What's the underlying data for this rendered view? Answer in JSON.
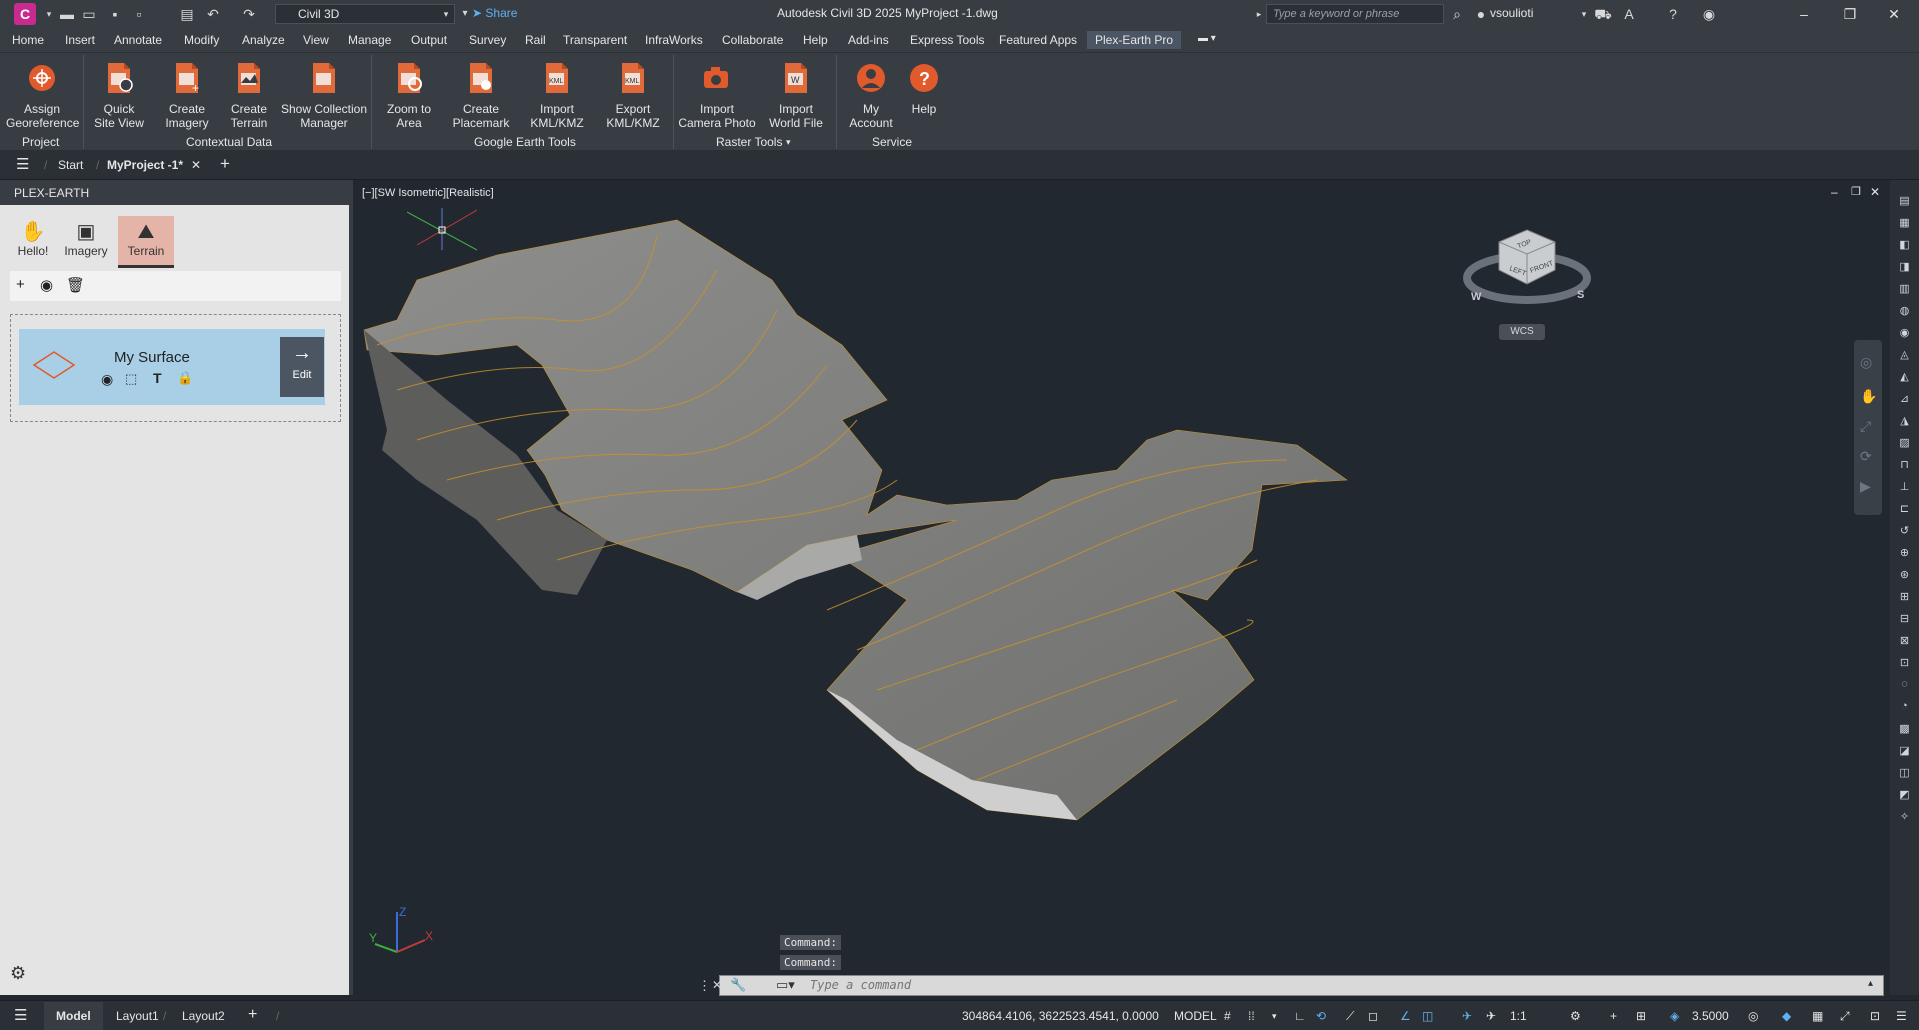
{
  "titlebar": {
    "workspace": "Civil 3D",
    "share": "Share",
    "title": "Autodesk Civil 3D 2025    MyProject -1.dwg",
    "search_placeholder": "Type a keyword or phrase",
    "user": "vsoulioti"
  },
  "menu": {
    "tabs": [
      "Home",
      "Insert",
      "Annotate",
      "Modify",
      "Analyze",
      "View",
      "Manage",
      "Output",
      "Survey",
      "Rail",
      "Transparent",
      "InfraWorks",
      "Collaborate",
      "Help",
      "Add-ins",
      "Express Tools",
      "Featured Apps",
      "Plex-Earth Pro"
    ],
    "active": "Plex-Earth Pro"
  },
  "ribbon": {
    "buttons": [
      {
        "l1": "Assign",
        "l2": "Georeference"
      },
      {
        "l1": "Quick",
        "l2": "Site View"
      },
      {
        "l1": "Create",
        "l2": "Imagery"
      },
      {
        "l1": "Create",
        "l2": "Terrain"
      },
      {
        "l1": "Show Collection",
        "l2": "Manager"
      },
      {
        "l1": "Zoom to",
        "l2": "Area"
      },
      {
        "l1": "Create",
        "l2": "Placemark"
      },
      {
        "l1": "Import",
        "l2": "KML/KMZ"
      },
      {
        "l1": "Export",
        "l2": "KML/KMZ"
      },
      {
        "l1": "Import",
        "l2": "Camera Photo"
      },
      {
        "l1": "Import",
        "l2": "World File"
      },
      {
        "l1": "My",
        "l2": "Account"
      },
      {
        "l1": "Help",
        "l2": ""
      }
    ],
    "panels": [
      "Project",
      "Contextual Data",
      "Google Earth Tools",
      "Raster Tools",
      "Service"
    ]
  },
  "doctabs": {
    "start": "Start",
    "active": "MyProject -1*"
  },
  "palette": {
    "title": "PLEX-EARTH",
    "tabs": [
      "Hello!",
      "Imagery",
      "Terrain"
    ],
    "surface_name": "My Surface",
    "edit_label": "Edit"
  },
  "viewport": {
    "label": "[−][SW Isometric][Realistic]",
    "cube_top": "TOP",
    "cube_left": "LEFT",
    "cube_front": "FRONT",
    "compass_w": "W",
    "compass_s": "S",
    "wcs": "WCS",
    "axis_x": "X",
    "axis_y": "Y",
    "axis_z": "Z"
  },
  "command": {
    "history": [
      "Command:",
      "Command:"
    ],
    "placeholder": "Type a command"
  },
  "status": {
    "tabs": [
      "Model",
      "Layout1",
      "Layout2"
    ],
    "coords": "304864.4106, 3622523.4541, 0.0000",
    "model": "MODEL",
    "scale": "1:1",
    "value": "3.5000"
  },
  "colors": {
    "accent": "#e05a2b",
    "app_logo": "#c82a8f",
    "contour": "#c8922a"
  }
}
